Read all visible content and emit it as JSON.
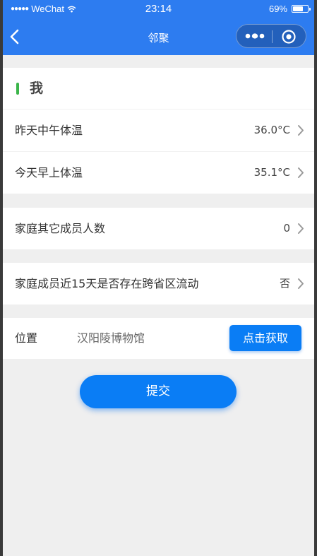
{
  "status_bar": {
    "signal": "●●●●●",
    "carrier": "WeChat",
    "time": "23:14",
    "battery_percent": "69%",
    "battery_level": 0.69
  },
  "nav": {
    "title": "邻聚",
    "icons": [
      "chevron-left-icon",
      "more-icon",
      "home-circle-icon"
    ]
  },
  "section": {
    "title": "我"
  },
  "temperatures": [
    {
      "label": "昨天中午体温",
      "value": "36.0°C"
    },
    {
      "label": "今天早上体温",
      "value": "35.1°C"
    }
  ],
  "family_members": {
    "label": "家庭其它成员人数",
    "value": "0"
  },
  "cross_province": {
    "label": "家庭成员近15天是否存在跨省区流动",
    "value": "否"
  },
  "location": {
    "label": "位置",
    "value": "汉阳陵博物馆",
    "fetch_button": "点击获取"
  },
  "submit_button": "提交",
  "colors": {
    "nav_bg": "#2d7cf0",
    "primary_button": "#0a7df5",
    "section_bar": "#3bb54a",
    "page_bg": "#efefef"
  }
}
